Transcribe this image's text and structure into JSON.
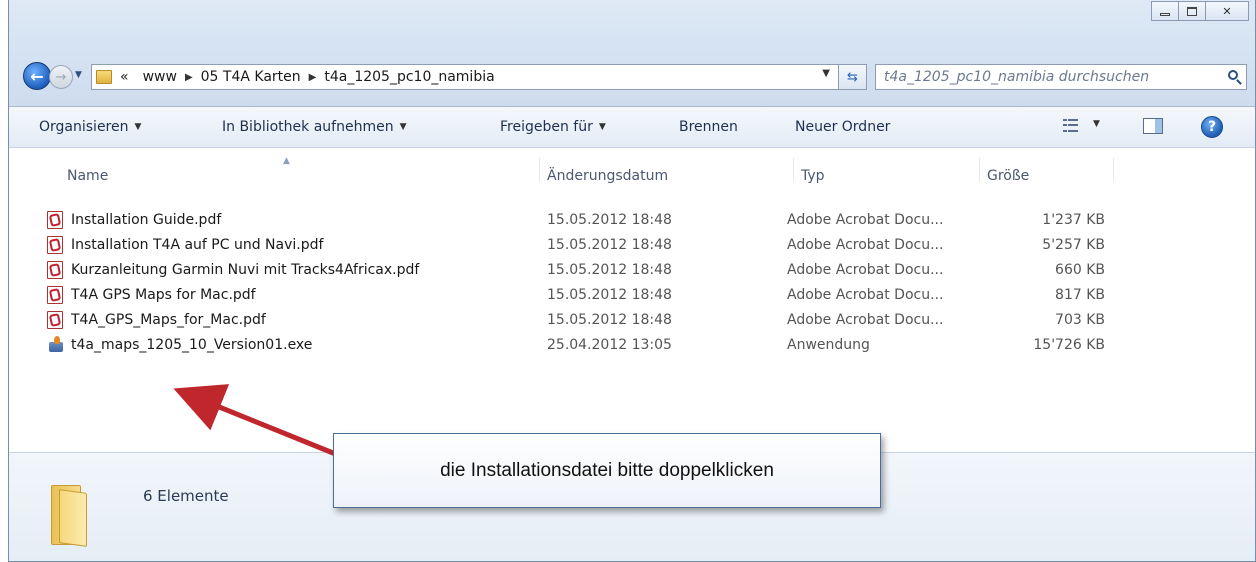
{
  "address": {
    "overflow": "«",
    "crumbs": [
      "www",
      "05 T4A Karten",
      "t4a_1205_pc10_namibia"
    ]
  },
  "search": {
    "placeholder": "t4a_1205_pc10_namibia durchsuchen"
  },
  "toolbar": {
    "organize": "Organisieren",
    "library": "In Bibliothek aufnehmen",
    "share": "Freigeben für",
    "burn": "Brennen",
    "new_folder": "Neuer Ordner"
  },
  "columns": {
    "name": "Name",
    "date": "Änderungsdatum",
    "type": "Typ",
    "size": "Größe"
  },
  "files": [
    {
      "name": "Installation Guide.pdf",
      "date": "15.05.2012 18:48",
      "type": "Adobe Acrobat Docu...",
      "size": "1'237 KB",
      "icon": "pdf-icon"
    },
    {
      "name": "Installation T4A auf PC und Navi.pdf",
      "date": "15.05.2012 18:48",
      "type": "Adobe Acrobat Docu...",
      "size": "5'257 KB",
      "icon": "pdf-icon"
    },
    {
      "name": "Kurzanleitung Garmin Nuvi mit Tracks4Africax.pdf",
      "date": "15.05.2012 18:48",
      "type": "Adobe Acrobat Docu...",
      "size": "660 KB",
      "icon": "pdf-icon"
    },
    {
      "name": "T4A GPS Maps for Mac.pdf",
      "date": "15.05.2012 18:48",
      "type": "Adobe Acrobat Docu...",
      "size": "817 KB",
      "icon": "pdf-icon"
    },
    {
      "name": "T4A_GPS_Maps_for_Mac.pdf",
      "date": "15.05.2012 18:48",
      "type": "Adobe Acrobat Docu...",
      "size": "703 KB",
      "icon": "pdf-icon"
    },
    {
      "name": "t4a_maps_1205_10_Version01.exe",
      "date": "25.04.2012 13:05",
      "type": "Anwendung",
      "size": "15'726 KB",
      "icon": "installer-icon"
    }
  ],
  "details": {
    "count": "6 Elemente"
  },
  "callout": {
    "text": "die Installationsdatei bitte doppelklicken"
  },
  "colors": {
    "arrow": "#c0272d",
    "accent": "#1e5fbd"
  }
}
